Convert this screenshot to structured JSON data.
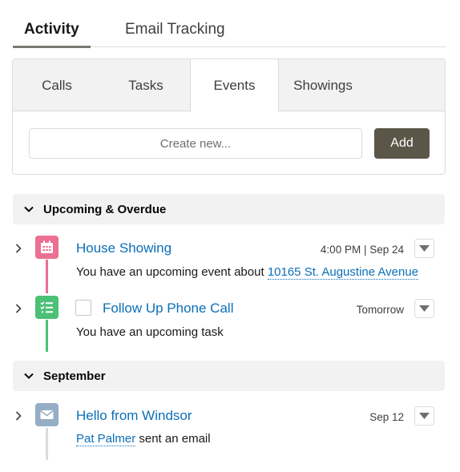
{
  "top_tabs": {
    "activity": "Activity",
    "email_tracking": "Email Tracking"
  },
  "inner_tabs": [
    "Calls",
    "Tasks",
    "Events",
    "Showings"
  ],
  "active_inner_tab": "Events",
  "composer": {
    "placeholder": "Create new...",
    "add_label": "Add"
  },
  "sections": [
    {
      "title": "Upcoming & Overdue",
      "items": [
        {
          "type": "event",
          "icon": "calendar-icon",
          "color": "#eb7092",
          "title": "House Showing",
          "date": "4:00 PM | Sep 24",
          "desc_prefix": "You have an upcoming event about ",
          "desc_link": "10165 St. Augustine Avenue"
        },
        {
          "type": "task",
          "icon": "task-list-icon",
          "color": "#4bc076",
          "title": "Follow Up Phone Call",
          "date": "Tomorrow",
          "desc": "You have an upcoming task"
        }
      ]
    },
    {
      "title": "September",
      "items": [
        {
          "type": "email",
          "icon": "email-icon",
          "color": "#95aec5",
          "title": "Hello from Windsor",
          "date": "Sep 12",
          "desc_link": "Pat Palmer",
          "desc_suffix": " sent an email"
        }
      ]
    }
  ]
}
